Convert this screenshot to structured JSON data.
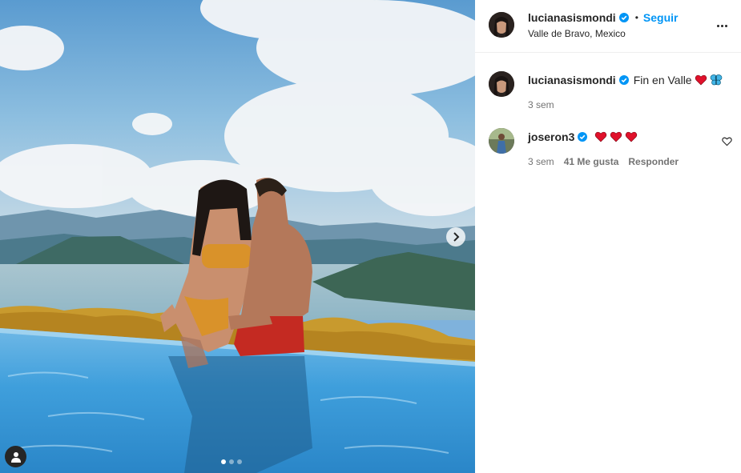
{
  "post": {
    "author": "lucianasismondi",
    "follow_label": "Seguir",
    "separator": "•",
    "location": "Valle de Bravo, Mexico",
    "carousel": {
      "slides": 3,
      "active_index": 0
    }
  },
  "caption": {
    "author": "lucianasismondi",
    "text": "Fin en Valle",
    "emojis": [
      "red-heart",
      "butterfly"
    ],
    "time": "3 sem"
  },
  "comments": [
    {
      "author": "joseron3",
      "emojis": [
        "red-heart",
        "red-heart",
        "red-heart"
      ],
      "time": "3 sem",
      "likes": "41 Me gusta",
      "reply_label": "Responder"
    }
  ],
  "colors": {
    "accent": "#0095f6",
    "text": "#262626",
    "secondary": "#737373",
    "heart": "#e0112b"
  }
}
